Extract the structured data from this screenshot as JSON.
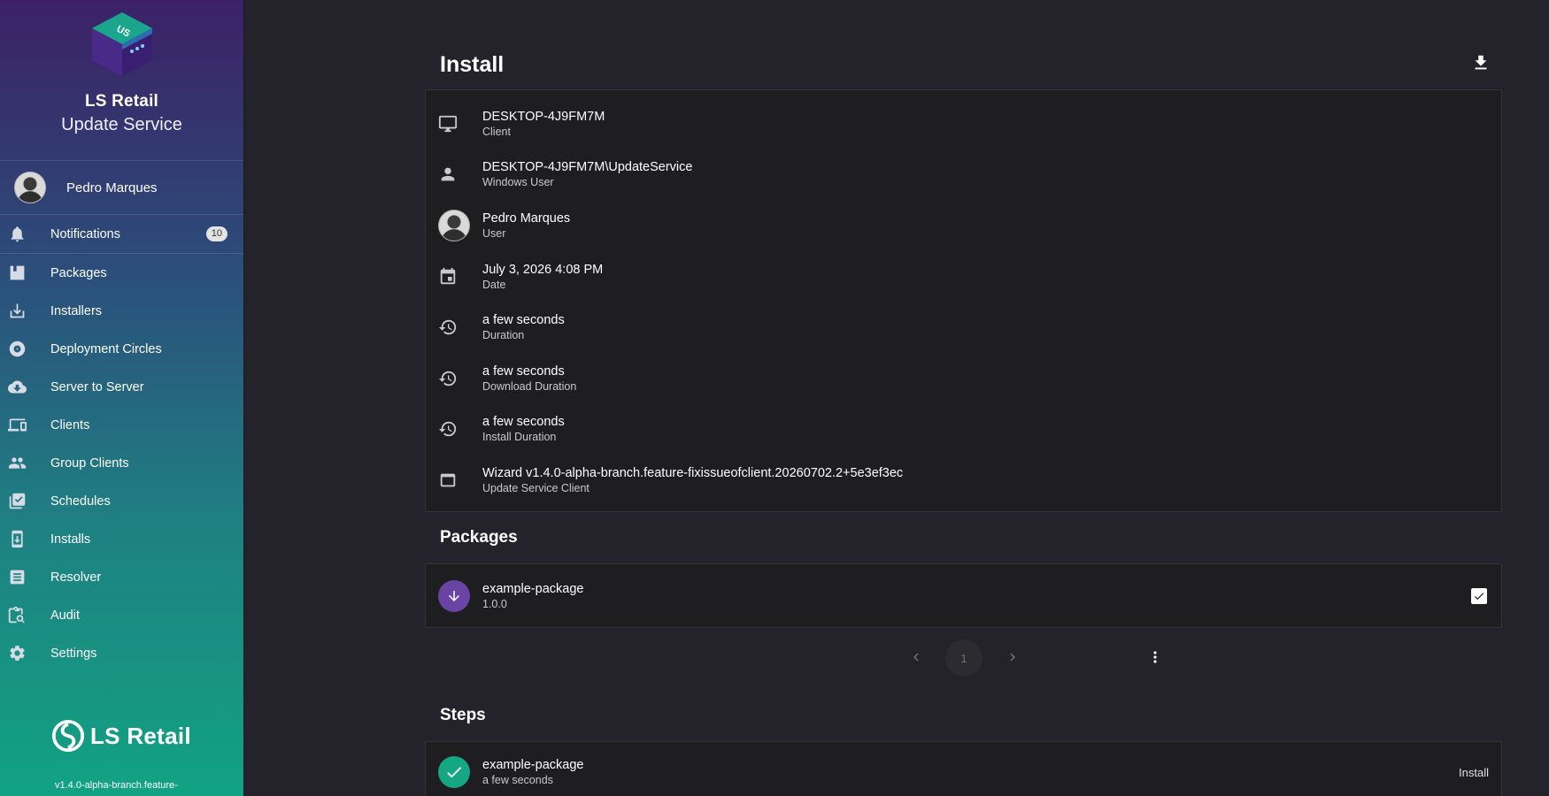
{
  "sidebar": {
    "brand_title": "LS Retail",
    "brand_subtitle": "Update Service",
    "brand_logo_text": "US",
    "user_name": "Pedro Marques",
    "items": [
      {
        "label": "Notifications",
        "icon": "bell-icon",
        "badge": "10"
      },
      {
        "label": "Packages",
        "icon": "package-icon"
      },
      {
        "label": "Installers",
        "icon": "download-tray-icon"
      },
      {
        "label": "Deployment Circles",
        "icon": "disc-icon"
      },
      {
        "label": "Server to Server",
        "icon": "cloud-download-icon"
      },
      {
        "label": "Clients",
        "icon": "devices-icon"
      },
      {
        "label": "Group Clients",
        "icon": "group-icon"
      },
      {
        "label": "Schedules",
        "icon": "calendar-check-icon"
      },
      {
        "label": "Installs",
        "icon": "phone-download-icon"
      },
      {
        "label": "Resolver",
        "icon": "list-document-icon"
      },
      {
        "label": "Audit",
        "icon": "clipboard-search-icon"
      },
      {
        "label": "Settings",
        "icon": "gear-icon"
      }
    ],
    "footer_logo_text": "LS Retail",
    "version": "v1.4.0-alpha-branch.feature-"
  },
  "main": {
    "title": "Install",
    "info": [
      {
        "primary": "DESKTOP-4J9FM7M",
        "secondary": "Client",
        "icon": "monitor-icon"
      },
      {
        "primary": "DESKTOP-4J9FM7M\\UpdateService",
        "secondary": "Windows User",
        "icon": "person-icon"
      },
      {
        "primary": "Pedro Marques",
        "secondary": "User",
        "icon": "avatar"
      },
      {
        "primary": "July 3, 2026 4:08 PM",
        "secondary": "Date",
        "icon": "calendar-icon"
      },
      {
        "primary": "a few seconds",
        "secondary": "Duration",
        "icon": "history-icon"
      },
      {
        "primary": "a few seconds",
        "secondary": "Download Duration",
        "icon": "history-icon"
      },
      {
        "primary": "a few seconds",
        "secondary": "Install Duration",
        "icon": "history-icon"
      },
      {
        "primary": "Wizard v1.4.0-alpha-branch.feature-fixissueofclient.20260702.2+5e3ef3ec",
        "secondary": "Update Service Client",
        "icon": "window-icon"
      }
    ],
    "packages_title": "Packages",
    "packages": [
      {
        "name": "example-package",
        "version": "1.0.0",
        "checked": true
      }
    ],
    "pagination": {
      "current_page": "1"
    },
    "steps_title": "Steps",
    "steps": [
      {
        "name": "example-package",
        "duration": "a few seconds",
        "status": "Install"
      }
    ]
  },
  "colors": {
    "background": "#24232b",
    "card": "#1e1e21",
    "accent_purple": "#6a44a5",
    "accent_green": "#15a683"
  }
}
